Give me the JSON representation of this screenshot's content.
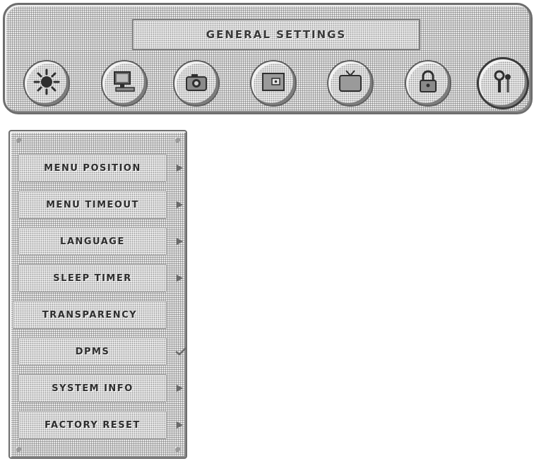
{
  "header": {
    "title": "GENERAL SETTINGS"
  },
  "icons": [
    {
      "name": "brightness-icon",
      "selected": false
    },
    {
      "name": "monitor-pc-icon",
      "selected": false
    },
    {
      "name": "camera-icon",
      "selected": false
    },
    {
      "name": "picture-in-picture-icon",
      "selected": false
    },
    {
      "name": "tv-icon",
      "selected": false
    },
    {
      "name": "lock-icon",
      "selected": false
    },
    {
      "name": "tools-icon",
      "selected": true
    }
  ],
  "menu": {
    "items": [
      {
        "label": "MENU POSITION",
        "indicator": "arrow-right"
      },
      {
        "label": "MENU TIMEOUT",
        "indicator": "arrow-right"
      },
      {
        "label": "LANGUAGE",
        "indicator": "arrow-right"
      },
      {
        "label": "SLEEP TIMER",
        "indicator": "arrow-right"
      },
      {
        "label": "TRANSPARENCY",
        "indicator": "none"
      },
      {
        "label": "DPMS",
        "indicator": "checkmark"
      },
      {
        "label": "SYSTEM INFO",
        "indicator": "arrow-right"
      },
      {
        "label": "FACTORY RESET",
        "indicator": "arrow-right"
      }
    ]
  }
}
